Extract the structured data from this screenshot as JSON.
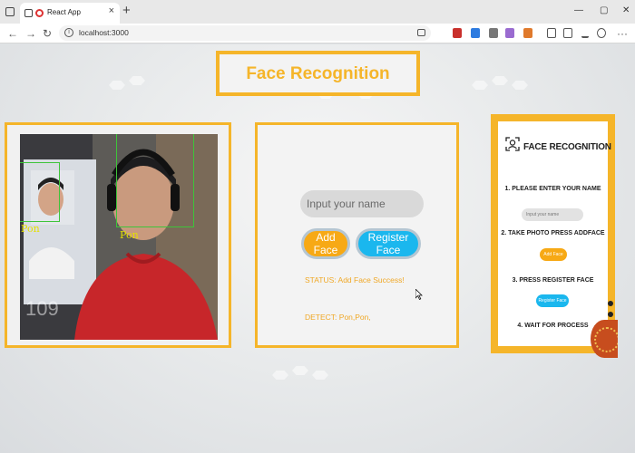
{
  "browser": {
    "tab_title": "React App",
    "tab_close": "×",
    "new_tab": "+",
    "url": "localhost:3000",
    "window_controls": {
      "minimize": "—",
      "maximize": "▢",
      "close": "✕"
    },
    "nav": {
      "back": "←",
      "forward": "→",
      "reload": "↻",
      "menu": "···"
    }
  },
  "app": {
    "title": "Face Recognition",
    "webcam": {
      "faces": [
        {
          "name": "Pon"
        },
        {
          "name": "Pon"
        }
      ]
    },
    "form": {
      "name_placeholder": "Input your name",
      "add_label": "Add Face",
      "register_label": "Register Face",
      "status": "STATUS: Add Face Success!",
      "detect": "DETECT: Pon,Pon,"
    },
    "guide": {
      "title": "FACE RECOGNITION",
      "steps": [
        "1. PLEASE ENTER YOUR NAME",
        "2. TAKE PHOTO PRESS ADDFACE",
        "3. PRESS REGISTER FACE",
        "4. WAIT FOR PROCESS"
      ],
      "input_placeholder": "Input your name",
      "add_label": "Add Face",
      "register_label": "Register Face"
    }
  },
  "colors": {
    "accent": "#f5b52a",
    "add_button": "#f7a915",
    "register_button": "#1ab7ee",
    "face_box": "#3ec43a",
    "face_label": "#e4e000"
  }
}
